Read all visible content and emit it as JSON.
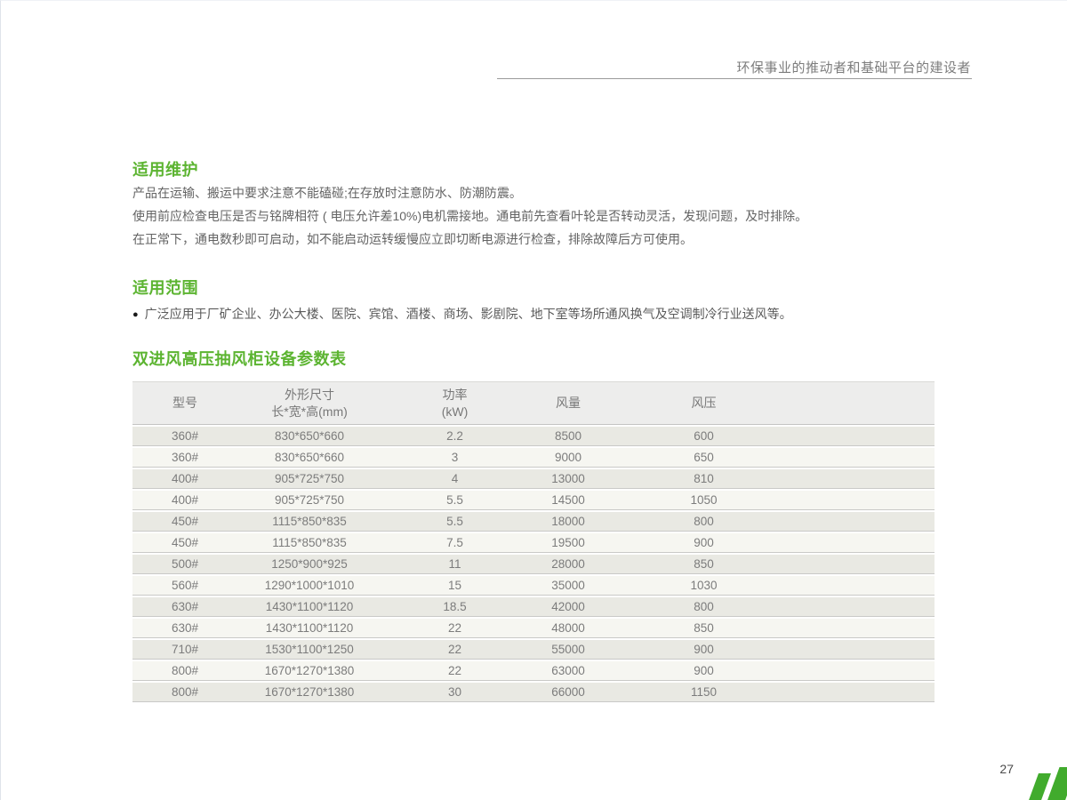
{
  "header": {
    "slogan": "环保事业的推动者和基础平台的建设者"
  },
  "sections": {
    "maintenance": {
      "heading": "适用维护",
      "lines": [
        "产品在运输、搬运中要求注意不能磕碰;在存放时注意防水、防潮防震。",
        "使用前应检查电压是否与铭牌相符 ( 电压允许差10%)电机需接地。通电前先查看叶轮是否转动灵活，发现问题，及时排除。",
        "在正常下，通电数秒即可启动，如不能启动运转缓慢应立即切断电源进行检查，排除故障后方可使用。"
      ]
    },
    "scope": {
      "heading": "适用范围",
      "bullet_icon": "●",
      "bullet": "广泛应用于厂矿企业、办公大楼、医院、宾馆、酒楼、商场、影剧院、地下室等场所通风换气及空调制冷行业送风等。"
    },
    "table_section": {
      "heading": "双进风高压抽风柜设备参数表"
    }
  },
  "table": {
    "columns": [
      {
        "line1": "型号",
        "line2": ""
      },
      {
        "line1": "外形尺寸",
        "line2": "长*宽*高(mm)"
      },
      {
        "line1": "功率",
        "line2": "(kW)"
      },
      {
        "line1": "风量",
        "line2": ""
      },
      {
        "line1": "风压",
        "line2": ""
      }
    ],
    "rows": [
      [
        "360#",
        "830*650*660",
        "2.2",
        "8500",
        "600"
      ],
      [
        "360#",
        "830*650*660",
        "3",
        "9000",
        "650"
      ],
      [
        "400#",
        "905*725*750",
        "4",
        "13000",
        "810"
      ],
      [
        "400#",
        "905*725*750",
        "5.5",
        "14500",
        "1050"
      ],
      [
        "450#",
        "1115*850*835",
        "5.5",
        "18000",
        "800"
      ],
      [
        "450#",
        "1115*850*835",
        "7.5",
        "19500",
        "900"
      ],
      [
        "500#",
        "1250*900*925",
        "11",
        "28000",
        "850"
      ],
      [
        "560#",
        "1290*1000*1010",
        "15",
        "35000",
        "1030"
      ],
      [
        "630#",
        "1430*1100*1120",
        "18.5",
        "42000",
        "800"
      ],
      [
        "630#",
        "1430*1100*1120",
        "22",
        "48000",
        "850"
      ],
      [
        "710#",
        "1530*1100*1250",
        "22",
        "55000",
        "900"
      ],
      [
        "800#",
        "1670*1270*1380",
        "22",
        "63000",
        "900"
      ],
      [
        "800#",
        "1670*1270*1380",
        "30",
        "66000",
        "1150"
      ]
    ]
  },
  "footer": {
    "page_number": "27"
  },
  "colors": {
    "accent_green": "#5cb431",
    "logo_green": "#41ab2d"
  }
}
